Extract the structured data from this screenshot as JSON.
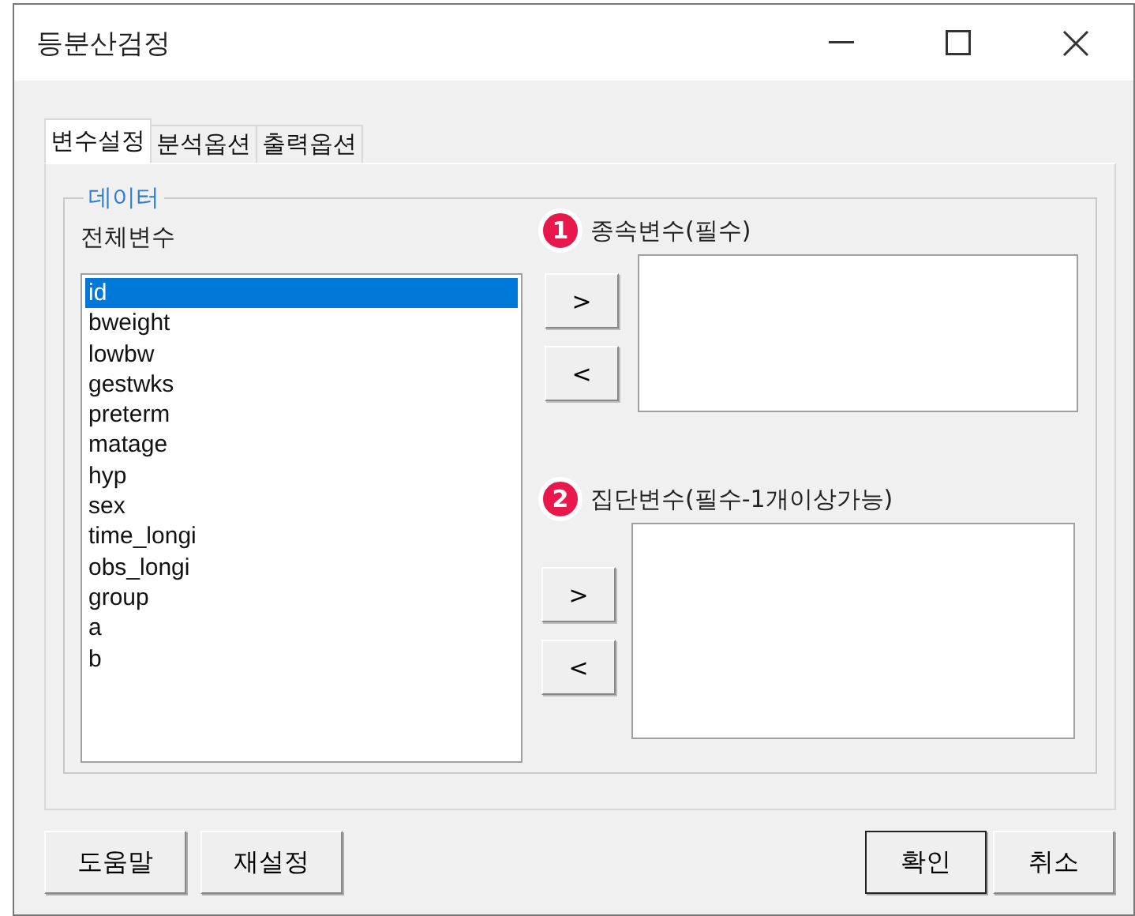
{
  "window": {
    "title": "등분산검정"
  },
  "tabs": [
    {
      "label": "변수설정",
      "selected": true
    },
    {
      "label": "분석옵션",
      "selected": false
    },
    {
      "label": "출력옵션",
      "selected": false
    }
  ],
  "group": {
    "title": "데이터"
  },
  "all_variables": {
    "label": "전체변수",
    "items": [
      {
        "label": "id",
        "selected": true
      },
      {
        "label": "bweight",
        "selected": false
      },
      {
        "label": "lowbw",
        "selected": false
      },
      {
        "label": "gestwks",
        "selected": false
      },
      {
        "label": "preterm",
        "selected": false
      },
      {
        "label": "matage",
        "selected": false
      },
      {
        "label": "hyp",
        "selected": false
      },
      {
        "label": "sex",
        "selected": false
      },
      {
        "label": "time_longi",
        "selected": false
      },
      {
        "label": "obs_longi",
        "selected": false
      },
      {
        "label": "group",
        "selected": false
      },
      {
        "label": "a",
        "selected": false
      },
      {
        "label": "b",
        "selected": false
      }
    ]
  },
  "targets": [
    {
      "number": "1",
      "label": "종속변수(필수)",
      "add": ">",
      "remove": "<"
    },
    {
      "number": "2",
      "label": "집단변수(필수-1개이상가능)",
      "add": ">",
      "remove": "<"
    }
  ],
  "buttons_left": [
    {
      "label": "도움말",
      "default": false
    },
    {
      "label": "재설정",
      "default": false
    }
  ],
  "buttons_right": [
    {
      "label": "확인",
      "default": true
    },
    {
      "label": "취소",
      "default": false
    }
  ]
}
